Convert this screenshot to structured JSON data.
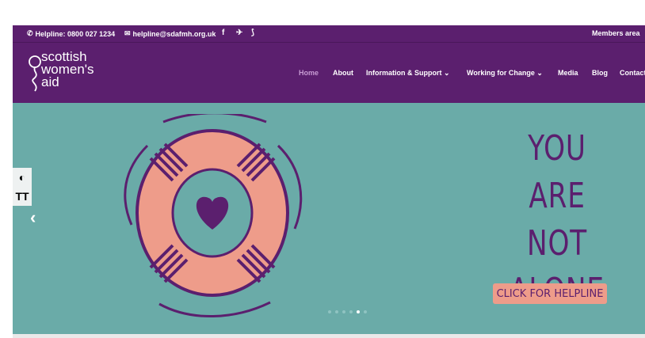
{
  "topbar": {
    "helpline": "Helpline: 0800 027 1234",
    "email": "helpline@sdafmh.org.uk",
    "members": "Members area",
    "social_icons": [
      "facebook-icon",
      "twitter-icon",
      "rss-icon"
    ]
  },
  "brand": {
    "line1": "scottish",
    "line2": "women's",
    "line3": "aid"
  },
  "menu": {
    "home": "Home",
    "about": "About",
    "info": "Information & Support",
    "working": "Working for Change",
    "media": "Media",
    "blog": "Blog",
    "contact": "Contact"
  },
  "accessibility": {
    "contrast_icon": "◐",
    "text_size": "TT"
  },
  "hero": {
    "line1": "YOU",
    "line2": "ARE NOT",
    "line3": "ALONE",
    "cta": "CLICK FOR HELPLINE",
    "prev_arrow": "‹",
    "active_slide": 5,
    "slide_count": 6
  },
  "colors": {
    "purple": "#5b1f6e",
    "teal": "#6aaba8",
    "coral": "#ee9c8a",
    "active_menu": "#c79bd3"
  }
}
